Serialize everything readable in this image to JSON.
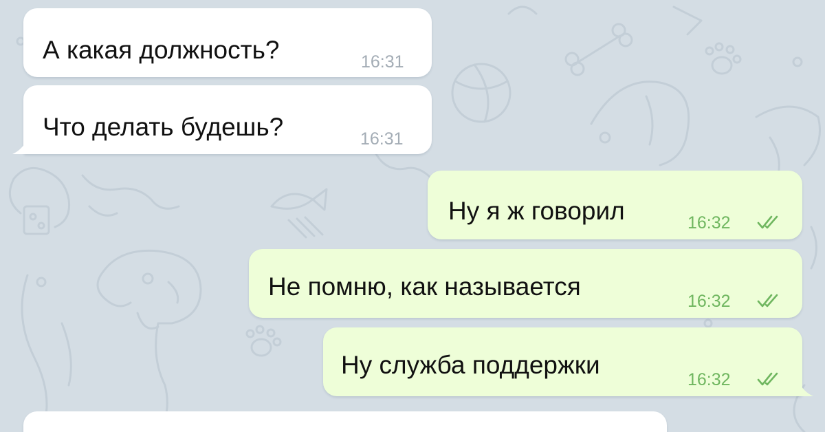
{
  "colors": {
    "background": "#d4dde4",
    "incoming_bubble": "#ffffff",
    "outgoing_bubble": "#eefed8",
    "incoming_time": "#a3acb5",
    "outgoing_time": "#6fb65f",
    "read_checkmarks": "#6fb65f"
  },
  "messages": [
    {
      "direction": "incoming",
      "text": "А какая должность?",
      "time": "16:31"
    },
    {
      "direction": "incoming",
      "text": "Что делать будешь?",
      "time": "16:31"
    },
    {
      "direction": "outgoing",
      "text": "Ну я ж говорил",
      "time": "16:32",
      "status_icon": "double-check-icon"
    },
    {
      "direction": "outgoing",
      "text": "Не помню, как называется",
      "time": "16:32",
      "status_icon": "double-check-icon"
    },
    {
      "direction": "outgoing",
      "text": "Ну служба поддержки",
      "time": "16:32",
      "status_icon": "double-check-icon"
    }
  ]
}
